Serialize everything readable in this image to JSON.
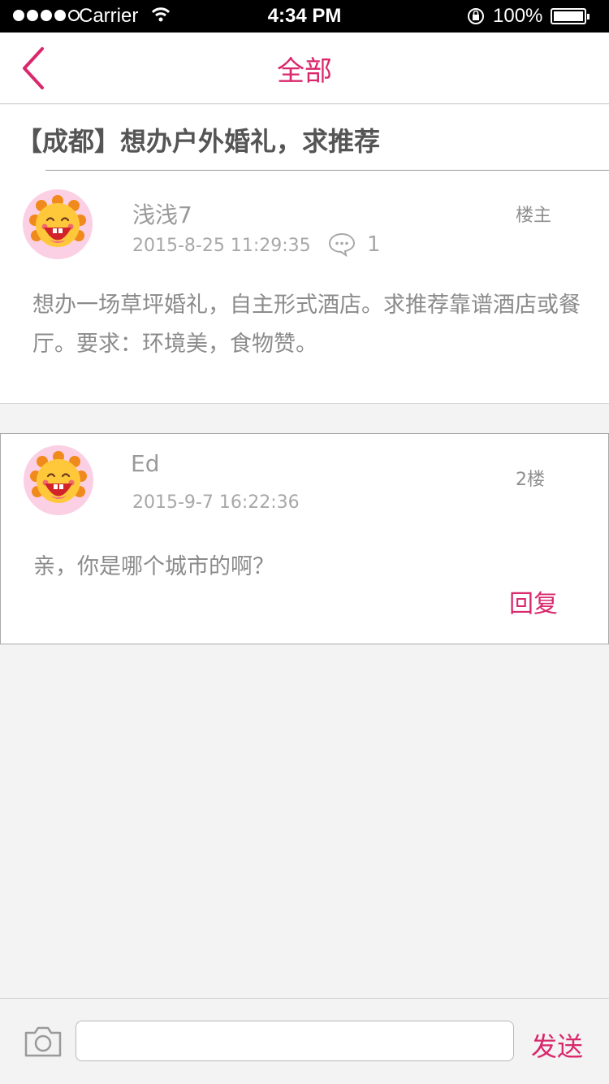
{
  "status_bar": {
    "carrier": "Carrier",
    "time": "4:34 PM",
    "battery": "100%"
  },
  "nav": {
    "title": "全部",
    "back_icon": "chevron-left-icon"
  },
  "post": {
    "title": "【成都】想办户外婚礼，求推荐",
    "author": "浅浅7",
    "floor_label": "楼主",
    "timestamp": "2015-8-25 11:29:35",
    "comment_count": "1",
    "content": "想办一场草坪婚礼，自主形式酒店。求推荐靠谱酒店或餐厅。要求：环境美，食物赞。"
  },
  "reply": {
    "author": "Ed",
    "floor_label": "2楼",
    "timestamp": "2015-9-7 16:22:36",
    "content": "亲，你是哪个城市的啊？",
    "reply_label": "回复"
  },
  "bottom_bar": {
    "input_value": "",
    "input_placeholder": "",
    "send_label": "发送"
  },
  "colors": {
    "accent": "#d9286c",
    "background": "#f3f3f3"
  }
}
